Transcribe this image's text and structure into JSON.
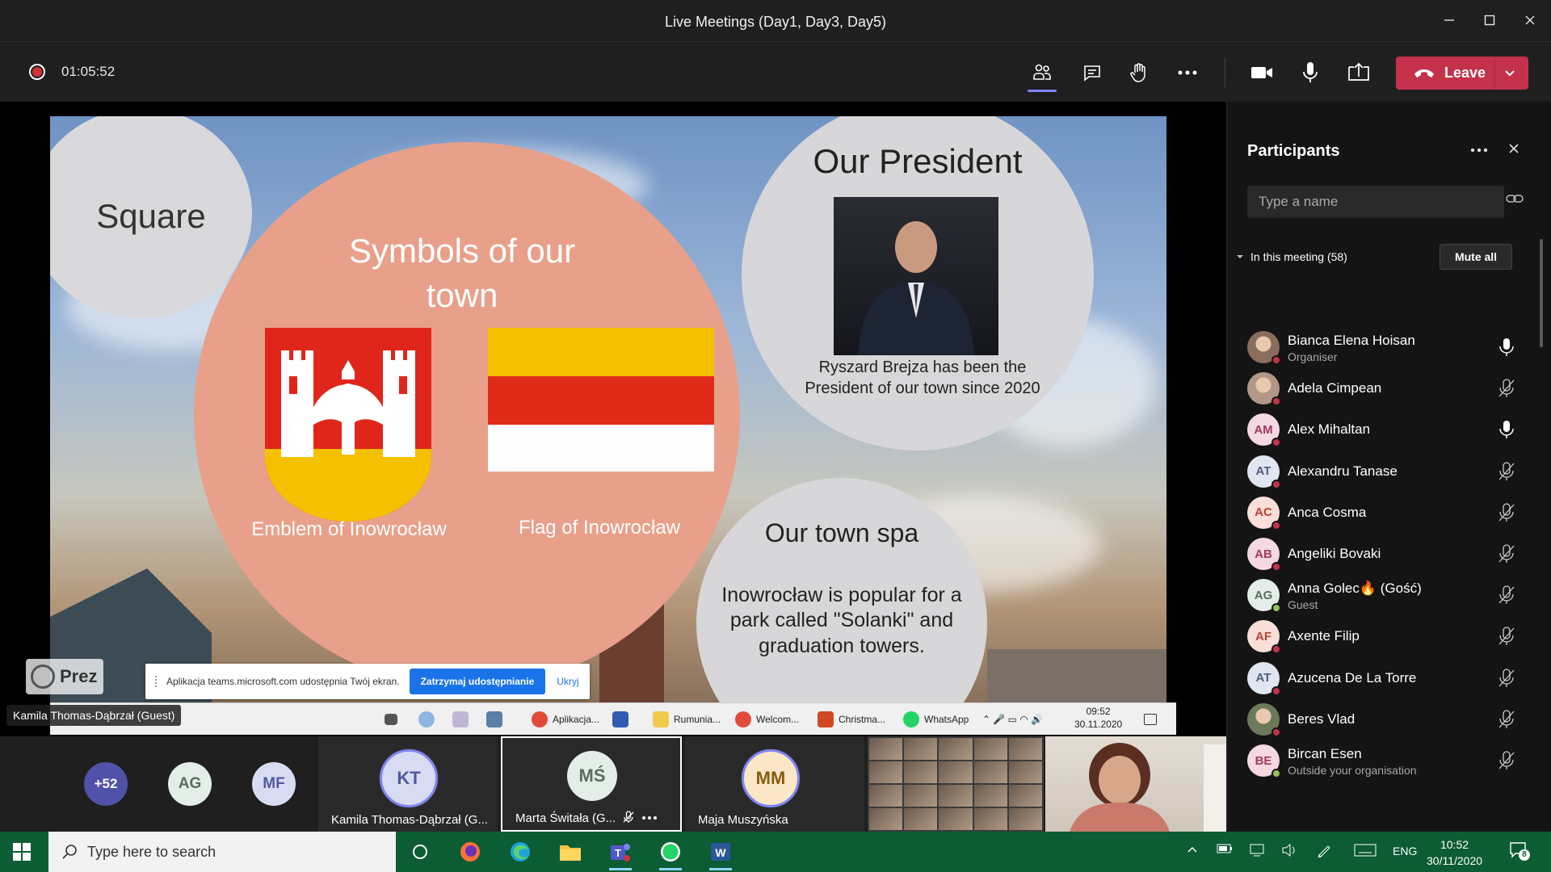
{
  "window": {
    "title": "Live Meetings (Day1, Day3, Day5)"
  },
  "toolbar": {
    "elapsed": "01:05:52",
    "leave_label": "Leave"
  },
  "slide": {
    "square_title": "Square",
    "symbols_title": "Symbols of our town",
    "emblem_label": "Emblem of Inowrocław",
    "flag_label": "Flag of Inowrocław",
    "president_title": "Our President",
    "president_desc": "Ryszard Brejza has been the President of our town since 2020",
    "spa_title": "Our town spa",
    "spa_desc": "Inowrocław is popular for a park called \"Solanki\" and graduation towers.",
    "prezi_label": "Prez",
    "flag_colors": [
      "#f5c000",
      "#e02a1a",
      "#fdfdfd"
    ]
  },
  "share_bar": {
    "message": "Aplikacja teams.microsoft.com udostępnia Twój ekran.",
    "stop_label": "Zatrzymaj udostępnianie",
    "hide_label": "Ukryj"
  },
  "inner_taskbar": {
    "items": [
      "Aplikacja...",
      "Rumunia...",
      "Welcom...",
      "Christma...",
      "WhatsApp"
    ],
    "time": "09:52",
    "date": "30.11.2020"
  },
  "presenter_label": "Kamila Thomas-Dąbrzał (Guest)",
  "gallery": {
    "overflow_count": "+52",
    "avatars": [
      {
        "initials": "AG",
        "color": "#e3eee8",
        "text_color": "#5b6c62"
      },
      {
        "initials": "MF",
        "color": "#d8dcf2",
        "text_color": "#4f5aa0"
      }
    ],
    "tiles": [
      {
        "initials": "KT",
        "name": "Kamila Thomas-Dąbrzał (G...",
        "color": "#d8dcf2",
        "text_color": "#4f5aa0"
      },
      {
        "initials": "MŚ",
        "name": "Marta Świtała (G...",
        "color": "#e3eee8",
        "text_color": "#5b6c62"
      },
      {
        "initials": "MM",
        "name": "Maja Muszyńska",
        "color": "#fbe7c6",
        "text_color": "#8a5a12"
      }
    ]
  },
  "participants": {
    "title": "Participants",
    "search_placeholder": "Type a name",
    "section_label": "In this meeting (58)",
    "mute_all_label": "Mute all",
    "list": [
      {
        "name": "Bianca Elena Hoisan",
        "role": "Organiser",
        "initials": "",
        "mic": "on",
        "status": "red"
      },
      {
        "name": "Adela Cimpean",
        "role": "",
        "initials": "",
        "mic": "off",
        "status": "red"
      },
      {
        "name": "Alex Mihaltan",
        "role": "",
        "initials": "AM",
        "mic": "on",
        "status": "red"
      },
      {
        "name": "Alexandru Tanase",
        "role": "",
        "initials": "AT",
        "mic": "off",
        "status": "red"
      },
      {
        "name": "Anca Cosma",
        "role": "",
        "initials": "AC",
        "mic": "off",
        "status": "red"
      },
      {
        "name": "Angeliki Bovaki",
        "role": "",
        "initials": "AB",
        "mic": "off",
        "status": "red"
      },
      {
        "name": "Anna Golec🔥 (Gość)",
        "role": "Guest",
        "initials": "AG",
        "mic": "off",
        "status": "green"
      },
      {
        "name": "Axente Filip",
        "role": "",
        "initials": "AF",
        "mic": "off",
        "status": "red"
      },
      {
        "name": "Azucena De La Torre",
        "role": "",
        "initials": "AT",
        "mic": "off",
        "status": "red"
      },
      {
        "name": "Beres Vlad",
        "role": "",
        "initials": "",
        "mic": "off",
        "status": "red"
      },
      {
        "name": "Bircan Esen",
        "role": "Outside your organisation",
        "initials": "BE",
        "mic": "off",
        "status": "green"
      }
    ]
  },
  "taskbar": {
    "search_placeholder": "Type here to search",
    "language": "ENG",
    "time": "10:52",
    "date": "30/11/2020",
    "notifications": "8"
  }
}
